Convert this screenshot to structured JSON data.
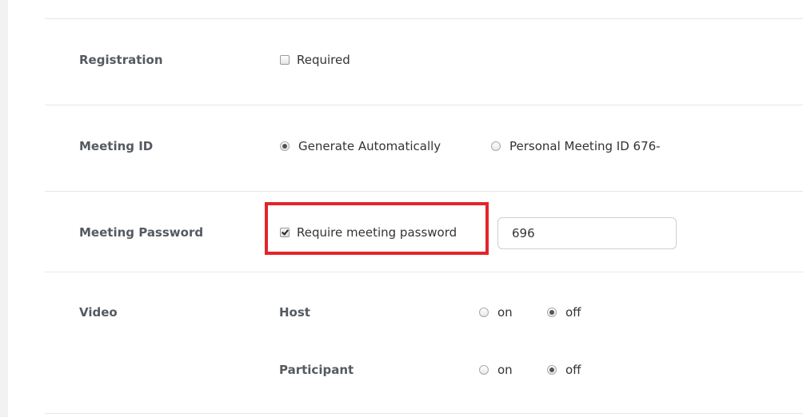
{
  "registration": {
    "label": "Registration",
    "required_label": "Required",
    "required_checked": false
  },
  "meeting_id": {
    "label": "Meeting ID",
    "options": [
      {
        "label": "Generate Automatically",
        "selected": true
      },
      {
        "label": "Personal Meeting ID 676-",
        "selected": false
      }
    ]
  },
  "meeting_password": {
    "label": "Meeting Password",
    "require_label": "Require meeting password",
    "require_checked": true,
    "password_value": "696"
  },
  "video": {
    "label": "Video",
    "host": {
      "label": "Host",
      "on_label": "on",
      "off_label": "off",
      "value": "off"
    },
    "participant": {
      "label": "Participant",
      "on_label": "on",
      "off_label": "off",
      "value": "off"
    }
  },
  "colors": {
    "highlight": "#e3242b",
    "label_text": "#555a61",
    "divider": "#e6e6e6"
  }
}
